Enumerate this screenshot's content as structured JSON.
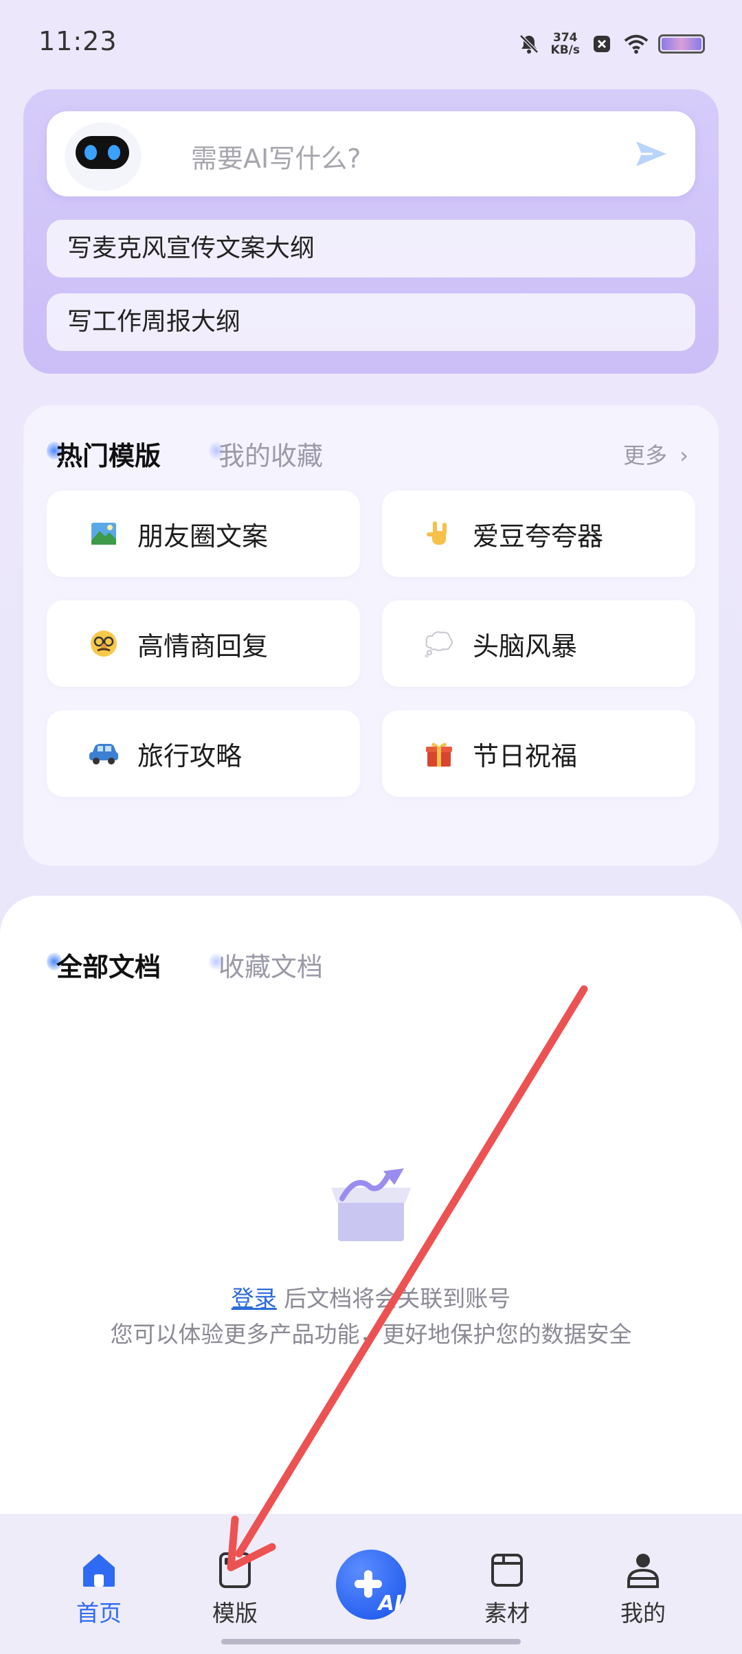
{
  "status_bar": {
    "time": "11:23",
    "speed_value": "374",
    "speed_unit": "KB/s",
    "icons": [
      "mute-bell-icon",
      "app-notification-icon",
      "wifi-icon",
      "battery-icon"
    ]
  },
  "ai_card": {
    "input_placeholder": "需要AI写什么?",
    "suggestions": [
      "写麦克风宣传文案大纲",
      "写工作周报大纲"
    ]
  },
  "templates": {
    "tabs": [
      {
        "label": "热门模版",
        "active": true
      },
      {
        "label": "我的收藏",
        "active": false
      }
    ],
    "more_label": "更多",
    "items": [
      {
        "label": "朋友圈文案",
        "icon": "landscape-photo-icon"
      },
      {
        "label": "爱豆夸夸器",
        "icon": "rock-hand-icon"
      },
      {
        "label": "高情商回复",
        "icon": "disguise-face-icon"
      },
      {
        "label": "头脑风暴",
        "icon": "thought-bubble-icon"
      },
      {
        "label": "旅行攻略",
        "icon": "car-icon"
      },
      {
        "label": "节日祝福",
        "icon": "gift-icon"
      }
    ]
  },
  "documents": {
    "tabs": [
      {
        "label": "全部文档",
        "active": true
      },
      {
        "label": "收藏文档",
        "active": false
      }
    ],
    "empty_state": {
      "login_link": "登录",
      "login_suffix": " 后文档将会关联到账号",
      "description": "您可以体验更多产品功能，更好地保护您的数据安全"
    }
  },
  "bottom_nav": {
    "items": [
      {
        "label": "首页",
        "icon": "home-icon",
        "active": true
      },
      {
        "label": "模版",
        "icon": "template-icon",
        "active": false
      },
      {
        "label": "",
        "icon": "ai-plus-icon",
        "fab_text": "AI"
      },
      {
        "label": "素材",
        "icon": "folder-icon",
        "active": false
      },
      {
        "label": "我的",
        "icon": "person-icon",
        "active": false
      }
    ]
  },
  "colors": {
    "accent_blue": "#2f6bf2",
    "card_purple": "#cbbdf6",
    "annotation_arrow": "#ec5252"
  }
}
